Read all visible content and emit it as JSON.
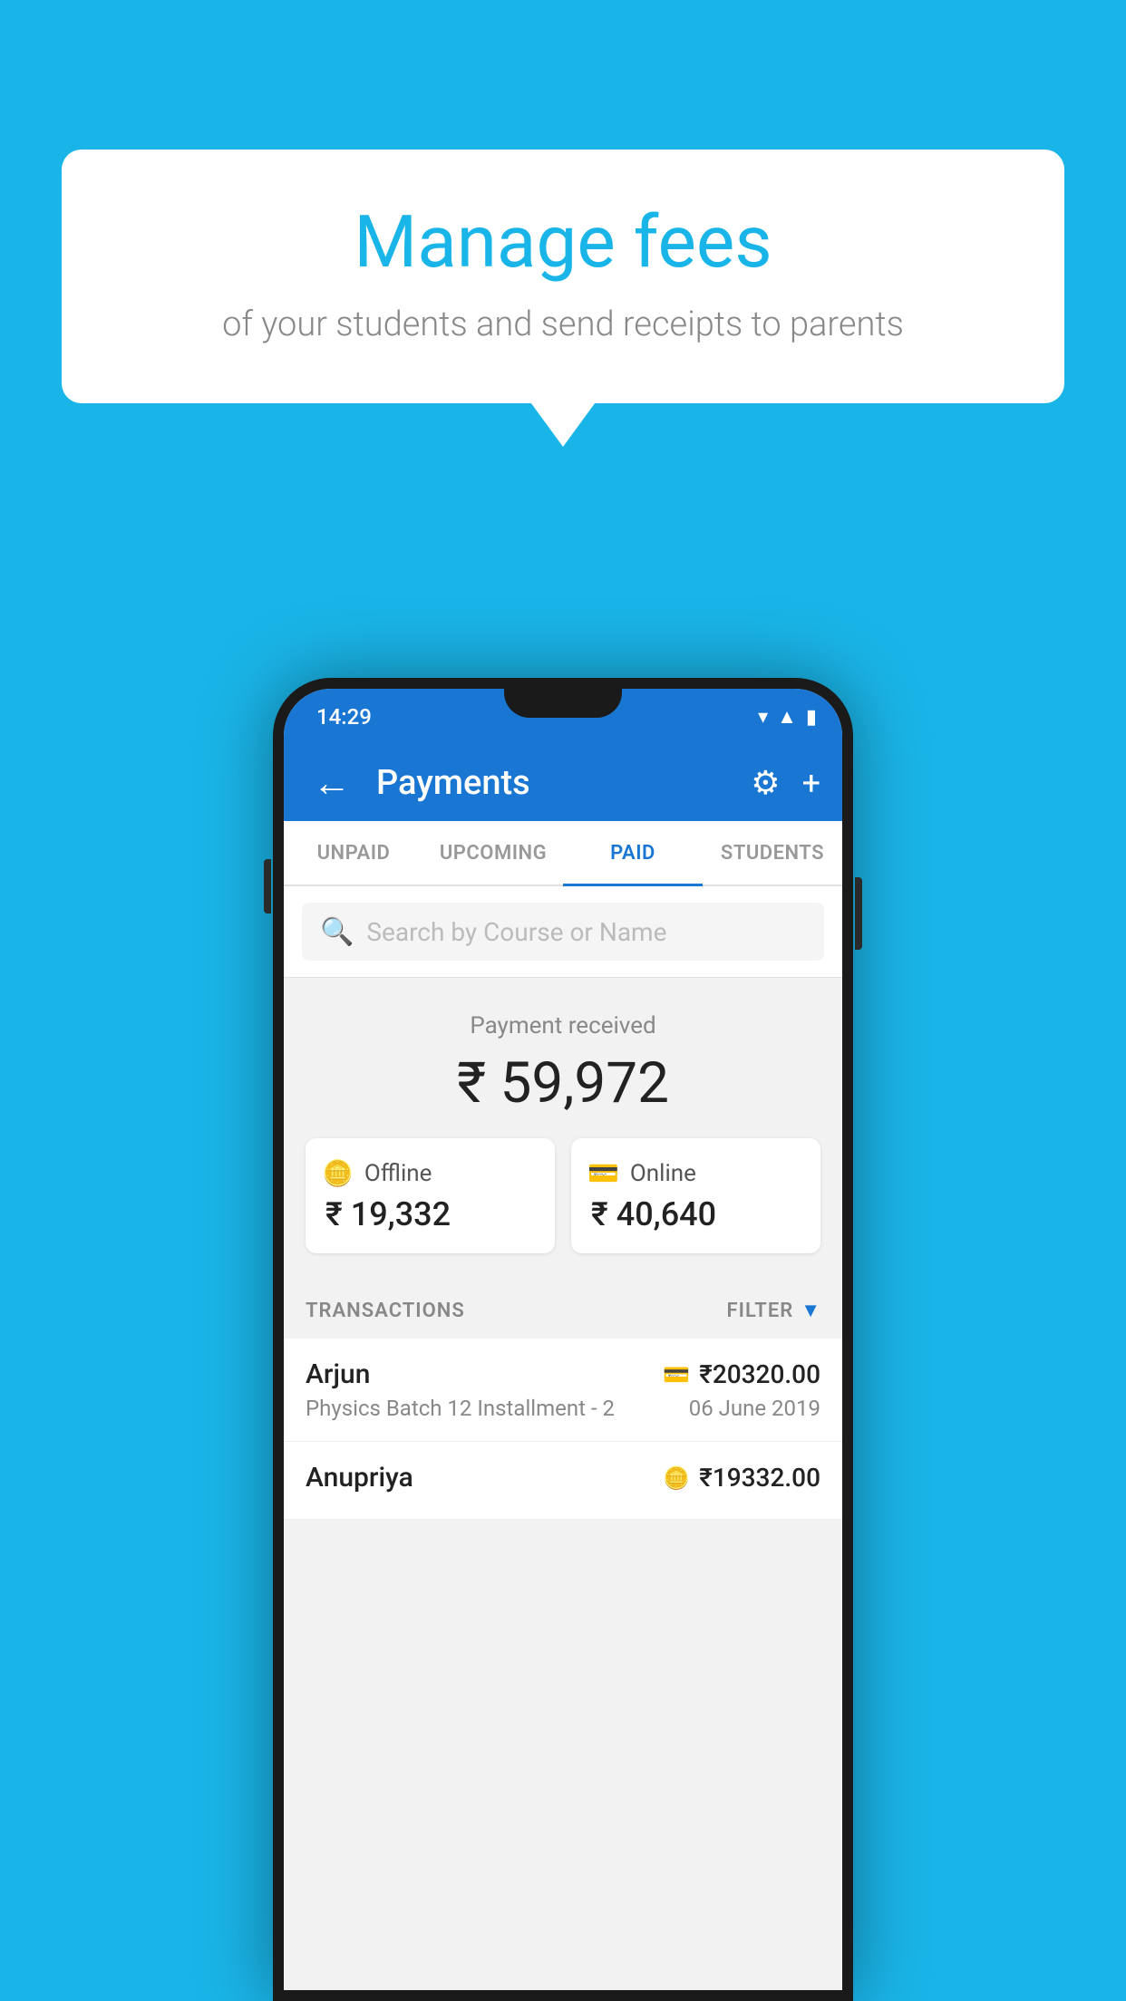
{
  "background_color": "#1ab5e8",
  "bubble": {
    "heading": "Manage fees",
    "subtext": "of your students and send receipts to parents"
  },
  "phone": {
    "status_bar": {
      "time": "14:29",
      "icons": [
        "wifi",
        "signal",
        "battery"
      ]
    },
    "app_bar": {
      "title": "Payments",
      "back_label": "←",
      "settings_icon": "⚙",
      "add_icon": "+"
    },
    "tabs": [
      {
        "label": "UNPAID",
        "active": false
      },
      {
        "label": "UPCOMING",
        "active": false
      },
      {
        "label": "PAID",
        "active": true
      },
      {
        "label": "STUDENTS",
        "active": false
      }
    ],
    "search": {
      "placeholder": "Search by Course or Name"
    },
    "payment_summary": {
      "label": "Payment received",
      "amount": "₹ 59,972",
      "offline": {
        "type": "Offline",
        "amount": "₹ 19,332"
      },
      "online": {
        "type": "Online",
        "amount": "₹ 40,640"
      }
    },
    "transactions": {
      "section_label": "TRANSACTIONS",
      "filter_label": "FILTER",
      "rows": [
        {
          "name": "Arjun",
          "course": "Physics Batch 12 Installment - 2",
          "amount": "₹20320.00",
          "date": "06 June 2019",
          "type": "online"
        },
        {
          "name": "Anupriya",
          "course": "",
          "amount": "₹19332.00",
          "date": "",
          "type": "offline"
        }
      ]
    }
  }
}
